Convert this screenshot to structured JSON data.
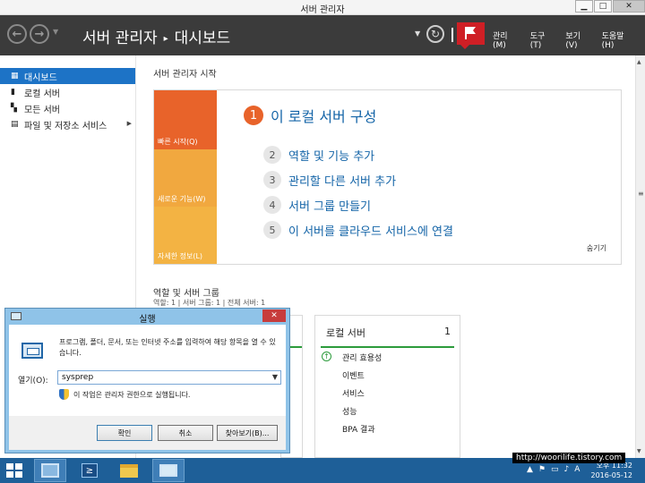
{
  "window": {
    "title": "서버 관리자",
    "controls": {
      "minimize": "▁",
      "maximize": "□",
      "close": "✕"
    }
  },
  "header": {
    "breadcrumb_root": "서버 관리자",
    "breadcrumb_separator": "▸",
    "breadcrumb_current": "대시보드",
    "back_glyph": "←",
    "forward_glyph": "→",
    "refresh_glyph": "↻",
    "menus": [
      "관리(M)",
      "도구(T)",
      "보기(V)",
      "도움말(H)"
    ],
    "flag_color": "#cf1f25"
  },
  "sidebar": {
    "items": [
      {
        "label": "대시보드",
        "icon": "dashboard-icon",
        "active": true
      },
      {
        "label": "로컬 서버",
        "icon": "server-icon"
      },
      {
        "label": "모든 서버",
        "icon": "servers-icon"
      },
      {
        "label": "파일 및 저장소 서비스",
        "icon": "storage-icon",
        "expand": "▶"
      }
    ]
  },
  "welcome": {
    "section_title": "서버 관리자 시작",
    "tiles": [
      "빠른 시작(Q)",
      "새로운 기능(W)",
      "자세한 정보(L)"
    ],
    "primary_step": {
      "num": "1",
      "label": "이 로컬 서버 구성"
    },
    "steps": [
      {
        "num": "2",
        "label": "역할 및 기능 추가"
      },
      {
        "num": "3",
        "label": "관리할 다른 서버 추가"
      },
      {
        "num": "4",
        "label": "서버 그룹 만들기"
      },
      {
        "num": "5",
        "label": "이 서버를 클라우드 서비스에 연결"
      }
    ],
    "hide": "숨기기"
  },
  "roles": {
    "title": "역할 및 서버 그룹",
    "counts": "역할: 1  |  서버 그룹: 1  |  전체 서버: 1",
    "card": {
      "title": "로컬 서버",
      "count": "1",
      "rows": [
        "관리 효용성",
        "이벤트",
        "서비스",
        "성능",
        "BPA 결과"
      ]
    }
  },
  "run_dialog": {
    "title": "실행",
    "close": "✕",
    "description": "프로그램, 폴더, 문서, 또는 인터넷 주소를 입력하여 해당 항목을 열 수 있습니다.",
    "open_label": "열기(O):",
    "input_value": "sysprep",
    "admin_note": "이 작업은 관리자 권한으로 실행됩니다.",
    "buttons": {
      "ok": "확인",
      "cancel": "취소",
      "browse": "찾아보기(B)..."
    }
  },
  "taskbar": {
    "apps": [
      "server-manager-icon",
      "powershell-icon",
      "file-explorer-icon",
      "run-icon"
    ],
    "ps_glyph": "≥",
    "tray_glyphs": [
      "▲",
      "⚑",
      "▭",
      "♪",
      "A"
    ],
    "time": "오후 11:32",
    "date": "2016-05-12"
  },
  "watermark": "http://woorilife.tistory.com"
}
